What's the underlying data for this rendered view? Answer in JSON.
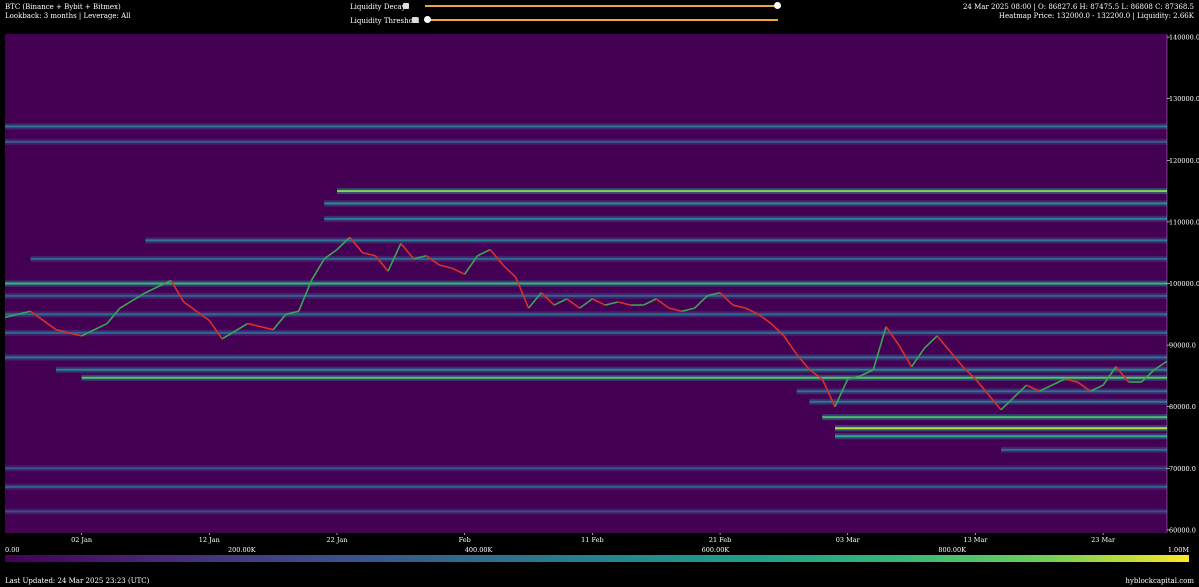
{
  "header": {
    "title": "BTC (Binance + Bybit + Bitmex)",
    "subtitle": "Lookback: 3 months | Leverage: All",
    "ohlc": "24 Mar 2025 08:00 | O: 86827.6 H: 87475.5 L: 86808 C: 87368.5",
    "heatmap_info": "Heatmap Price: 132000.0 - 132200.0 | Liquidity: 2.66K"
  },
  "controls": {
    "decay_label": "Liquidity Decay",
    "decay_value": 1.0,
    "threshold_label": "Liquidity Threshold",
    "threshold_value": 0.0
  },
  "colorbar": {
    "labels": [
      "0.00",
      "200.00K",
      "400.00K",
      "600.00K",
      "800.00K",
      "1.00M"
    ]
  },
  "footer": {
    "updated": "Last Updated: 24 Mar 2025 23:23 (UTC)",
    "brand": "hyblockcapital.com"
  },
  "colors": {
    "background": "#440154",
    "low": "#440154",
    "mid": "#21918c",
    "high": "#fde725",
    "candle_up": "#3aa655",
    "candle_down": "#d6312b"
  },
  "chart_data": {
    "type": "heatmap",
    "title": "",
    "x_ticks": [
      "02 Jan",
      "12 Jan",
      "22 Jan",
      "Feb",
      "11 Feb",
      "21 Feb",
      "03 Mar",
      "13 Mar",
      "23 Mar"
    ],
    "y_ticks": [
      140000,
      130000,
      120000,
      110000,
      100000,
      90000,
      80000,
      70000,
      60000
    ],
    "y_tick_labels": [
      "140000.0",
      "130000.0",
      "120000.0",
      "110000.0",
      "100000.0",
      "90000.0",
      "80000.0",
      "70000.0",
      "60000.0"
    ],
    "ylim": [
      59500,
      140500
    ],
    "x_range_days": [
      -4,
      87
    ],
    "liquidity_scale": [
      0,
      1000000
    ],
    "price_series": {
      "name": "BTC",
      "points": [
        [
          -4,
          94500
        ],
        [
          -2,
          95500
        ],
        [
          0,
          92500
        ],
        [
          2,
          91500
        ],
        [
          4,
          93500
        ],
        [
          5,
          96000
        ],
        [
          7,
          98500
        ],
        [
          9,
          100500
        ],
        [
          10,
          97000
        ],
        [
          12,
          94000
        ],
        [
          13,
          91000
        ],
        [
          15,
          93500
        ],
        [
          17,
          92500
        ],
        [
          18,
          95000
        ],
        [
          19,
          95500
        ],
        [
          20,
          100500
        ],
        [
          21,
          104000
        ],
        [
          22,
          105500
        ],
        [
          23,
          107500
        ],
        [
          24,
          105000
        ],
        [
          25,
          104500
        ],
        [
          26,
          102000
        ],
        [
          27,
          106500
        ],
        [
          28,
          104000
        ],
        [
          29,
          104500
        ],
        [
          30,
          103000
        ],
        [
          31,
          102500
        ],
        [
          32,
          101500
        ],
        [
          33,
          104500
        ],
        [
          34,
          105500
        ],
        [
          35,
          103000
        ],
        [
          36,
          101000
        ],
        [
          37,
          96000
        ],
        [
          38,
          98500
        ],
        [
          39,
          96500
        ],
        [
          40,
          97500
        ],
        [
          41,
          96000
        ],
        [
          42,
          97500
        ],
        [
          43,
          96500
        ],
        [
          44,
          97000
        ],
        [
          45,
          96500
        ],
        [
          46,
          96500
        ],
        [
          47,
          97500
        ],
        [
          48,
          96000
        ],
        [
          49,
          95500
        ],
        [
          50,
          96000
        ],
        [
          51,
          98000
        ],
        [
          52,
          98500
        ],
        [
          53,
          96500
        ],
        [
          54,
          96000
        ],
        [
          55,
          95000
        ],
        [
          56,
          93500
        ],
        [
          57,
          91500
        ],
        [
          58,
          88500
        ],
        [
          59,
          86000
        ],
        [
          60,
          84500
        ],
        [
          61,
          80000
        ],
        [
          62,
          84500
        ],
        [
          63,
          85000
        ],
        [
          64,
          86000
        ],
        [
          65,
          93000
        ],
        [
          66,
          90000
        ],
        [
          67,
          86500
        ],
        [
          68,
          89500
        ],
        [
          69,
          91500
        ],
        [
          70,
          89000
        ],
        [
          71,
          86500
        ],
        [
          72,
          84500
        ],
        [
          73,
          82000
        ],
        [
          74,
          79500
        ],
        [
          75,
          81500
        ],
        [
          76,
          83500
        ],
        [
          77,
          82500
        ],
        [
          78,
          83500
        ],
        [
          79,
          84500
        ],
        [
          80,
          84000
        ],
        [
          81,
          82500
        ],
        [
          82,
          83500
        ],
        [
          83,
          86500
        ],
        [
          84,
          84000
        ],
        [
          85,
          84000
        ],
        [
          86,
          86000
        ],
        [
          87,
          87368
        ]
      ]
    },
    "liquidity_levels": [
      {
        "price": 125500,
        "liquidity": 450000
      },
      {
        "price": 123000,
        "liquidity": 320000
      },
      {
        "price": 115000,
        "liquidity": 900000
      },
      {
        "price": 113000,
        "liquidity": 550000
      },
      {
        "price": 110500,
        "liquidity": 500000
      },
      {
        "price": 107000,
        "liquidity": 450000
      },
      {
        "price": 104000,
        "liquidity": 380000
      },
      {
        "price": 100000,
        "liquidity": 750000
      },
      {
        "price": 98000,
        "liquidity": 350000
      },
      {
        "price": 95000,
        "liquidity": 400000
      },
      {
        "price": 92000,
        "liquidity": 380000
      },
      {
        "price": 88000,
        "liquidity": 450000
      },
      {
        "price": 86000,
        "liquidity": 520000
      },
      {
        "price": 84700,
        "liquidity": 820000
      },
      {
        "price": 82500,
        "liquidity": 420000
      },
      {
        "price": 80800,
        "liquidity": 470000
      },
      {
        "price": 78300,
        "liquidity": 800000
      },
      {
        "price": 76500,
        "liquidity": 950000
      },
      {
        "price": 75200,
        "liquidity": 700000
      },
      {
        "price": 73000,
        "liquidity": 400000
      },
      {
        "price": 70000,
        "liquidity": 300000
      },
      {
        "price": 67000,
        "liquidity": 350000
      },
      {
        "price": 63000,
        "liquidity": 250000
      }
    ]
  }
}
